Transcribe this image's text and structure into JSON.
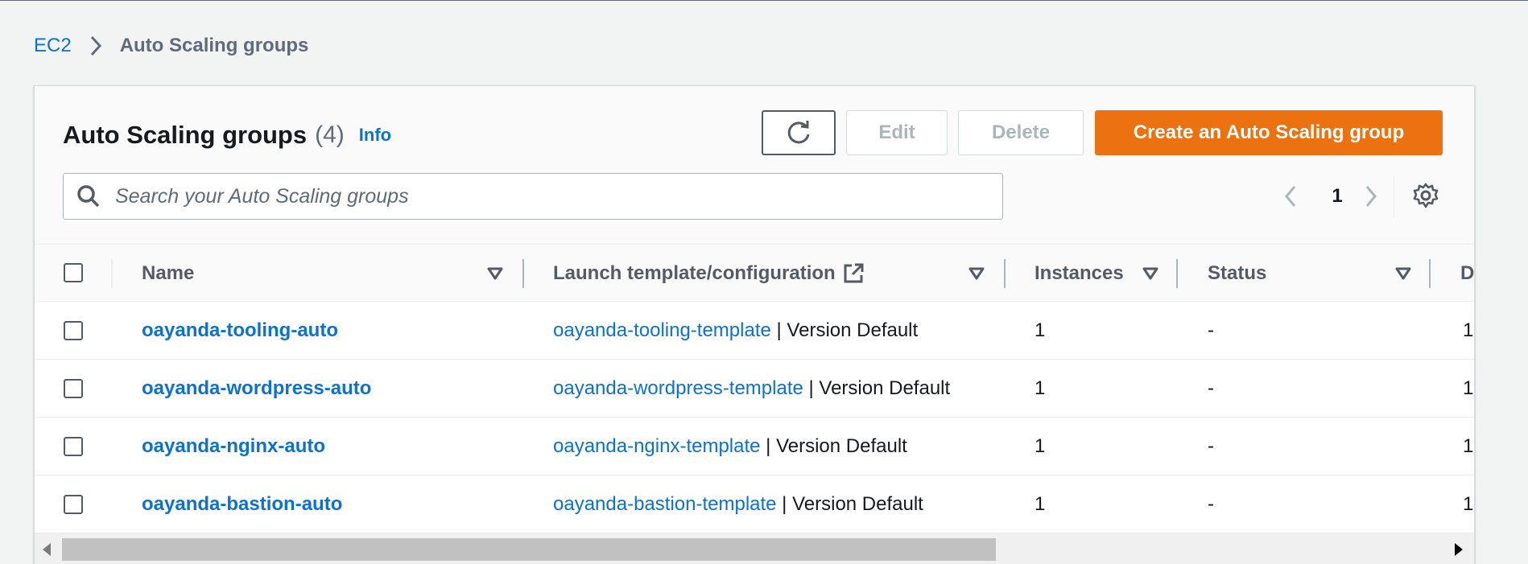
{
  "breadcrumb": {
    "parent": "EC2",
    "current": "Auto Scaling groups"
  },
  "header": {
    "title": "Auto Scaling groups",
    "count": "(4)",
    "info": "Info",
    "edit_label": "Edit",
    "delete_label": "Delete",
    "create_label": "Create an Auto Scaling group"
  },
  "search": {
    "placeholder": "Search your Auto Scaling groups"
  },
  "pagination": {
    "page": "1"
  },
  "columns": {
    "name": "Name",
    "launch": "Launch template/configuration",
    "instances": "Instances",
    "status": "Status",
    "next": "D"
  },
  "rows": [
    {
      "name": "oayanda-tooling-auto",
      "template": "oayanda-tooling-template",
      "version": " | Version Default",
      "instances": "1",
      "status": "-",
      "next": "1"
    },
    {
      "name": "oayanda-wordpress-auto",
      "template": "oayanda-wordpress-template",
      "version": " | Version Default",
      "instances": "1",
      "status": "-",
      "next": "1"
    },
    {
      "name": "oayanda-nginx-auto",
      "template": "oayanda-nginx-template",
      "version": " | Version Default",
      "instances": "1",
      "status": "-",
      "next": "1"
    },
    {
      "name": "oayanda-bastion-auto",
      "template": "oayanda-bastion-template",
      "version": " | Version Default",
      "instances": "1",
      "status": "-",
      "next": "1"
    }
  ],
  "colors": {
    "link": "#0972d3",
    "primary": "#ec7211",
    "text": "#16191f",
    "muted": "#5f6b7a"
  }
}
